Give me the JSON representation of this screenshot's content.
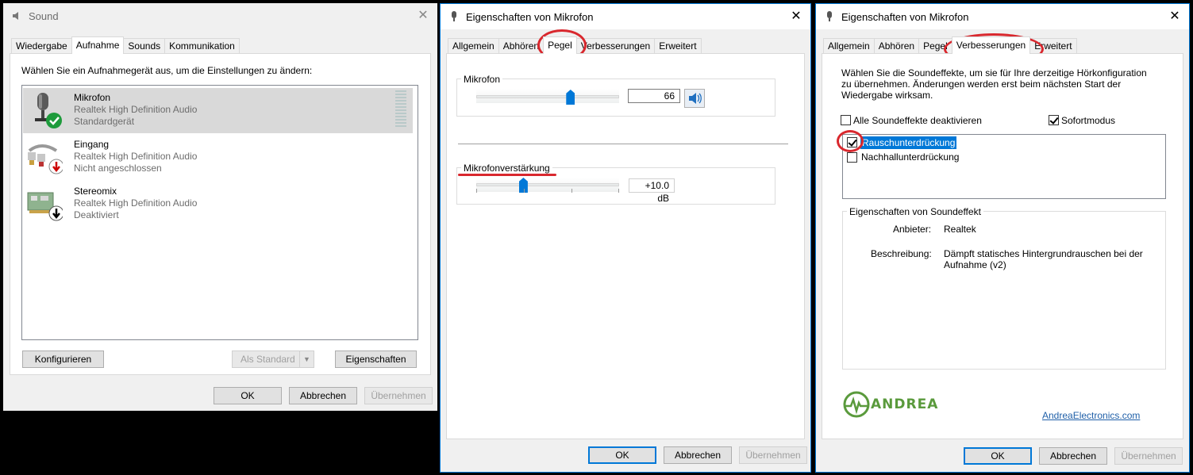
{
  "sound_window": {
    "title": "Sound",
    "tabs": [
      "Wiedergabe",
      "Aufnahme",
      "Sounds",
      "Kommunikation"
    ],
    "instruction": "Wählen Sie ein Aufnahmegerät aus, um die Einstellungen zu ändern:",
    "devices": [
      {
        "name": "Mikrofon",
        "driver": "Realtek High Definition Audio",
        "status": "Standardgerät"
      },
      {
        "name": "Eingang",
        "driver": "Realtek High Definition Audio",
        "status": "Nicht angeschlossen"
      },
      {
        "name": "Stereomix",
        "driver": "Realtek High Definition Audio",
        "status": "Deaktiviert"
      }
    ],
    "configure_label": "Konfigurieren",
    "set_default_label": "Als Standard",
    "properties_label": "Eigenschaften",
    "ok_label": "OK",
    "cancel_label": "Abbrechen",
    "apply_label": "Übernehmen"
  },
  "props_level_window": {
    "title": "Eigenschaften von Mikrofon",
    "tabs": [
      "Allgemein",
      "Abhören",
      "Pegel",
      "Verbesserungen",
      "Erweitert"
    ],
    "mic_group_label": "Mikrofon",
    "mic_level_value": "66",
    "mic_level_fraction": 0.66,
    "boost_group_label": "Mikrofonverstärkung",
    "boost_value": "+10.0 dB",
    "boost_fraction": 0.33,
    "ok_label": "OK",
    "cancel_label": "Abbrechen",
    "apply_label": "Übernehmen"
  },
  "props_enh_window": {
    "title": "Eigenschaften von Mikrofon",
    "tabs": [
      "Allgemein",
      "Abhören",
      "Pegel",
      "Verbesserungen",
      "Erweitert"
    ],
    "description": [
      "Wählen Sie die Soundeffekte, um sie für Ihre derzeitige Hörkonfiguration",
      "zu übernehmen. Änderungen werden erst beim nächsten Start der",
      "Wiedergabe wirksam."
    ],
    "disable_all_label": "Alle Soundeffekte deaktivieren",
    "immediate_mode_label": "Sofortmodus",
    "effects": [
      {
        "label": "Rauschunterdrückung",
        "checked": true
      },
      {
        "label": "Nachhallunterdrückung",
        "checked": false
      }
    ],
    "effect_props_group_label": "Eigenschaften von Soundeffekt",
    "provider_label": "Anbieter:",
    "provider_value": "Realtek",
    "desc_label": "Beschreibung:",
    "desc_value_lines": [
      "Dämpft statisches Hintergrundrauschen bei der",
      "Aufnahme (v2)"
    ],
    "logo_text": "ANDREA",
    "link_text": "AndreaElectronics.com",
    "ok_label": "OK",
    "cancel_label": "Abbrechen",
    "apply_label": "Übernehmen"
  },
  "colors": {
    "accent": "#0078d7",
    "annotation_red": "#d9282e",
    "selection": "#0078d7",
    "logo_green": "#5a9a3c"
  }
}
